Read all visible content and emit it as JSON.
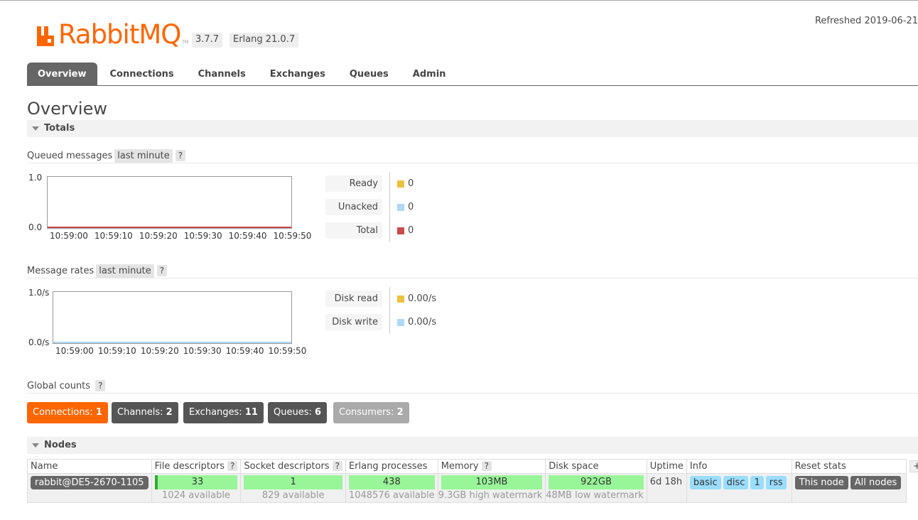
{
  "header": {
    "logo_text": "RabbitMQ",
    "logo_tm": "TM",
    "version": "3.7.7",
    "erlang": "Erlang 21.0.7",
    "refreshed": "Refreshed 2019-06-21"
  },
  "tabs": [
    "Overview",
    "Connections",
    "Channels",
    "Exchanges",
    "Queues",
    "Admin"
  ],
  "page_title": "Overview",
  "totals": {
    "heading": "Totals",
    "queued": {
      "label": "Queued messages",
      "range": "last minute",
      "help": "?",
      "y_max": "1.0",
      "y_min": "0.0",
      "ticks": [
        "10:59:00",
        "10:59:10",
        "10:59:20",
        "10:59:30",
        "10:59:40",
        "10:59:50"
      ],
      "legend": [
        {
          "label": "Ready",
          "value": "0",
          "color": "#edc240"
        },
        {
          "label": "Unacked",
          "value": "0",
          "color": "#afd8f8"
        },
        {
          "label": "Total",
          "value": "0",
          "color": "#cb4b4b"
        }
      ]
    },
    "rates": {
      "label": "Message rates",
      "range": "last minute",
      "help": "?",
      "y_max": "1.0/s",
      "y_min": "0.0/s",
      "ticks": [
        "10:59:00",
        "10:59:10",
        "10:59:20",
        "10:59:30",
        "10:59:40",
        "10:59:50"
      ],
      "legend": [
        {
          "label": "Disk read",
          "value": "0.00/s",
          "color": "#edc240"
        },
        {
          "label": "Disk write",
          "value": "0.00/s",
          "color": "#afd8f8"
        }
      ]
    },
    "global": {
      "label": "Global counts",
      "help": "?",
      "badges": [
        {
          "label": "Connections:",
          "value": "1",
          "color": "#f60"
        },
        {
          "label": "Channels:",
          "value": "2",
          "color": "#555"
        },
        {
          "label": "Exchanges:",
          "value": "11",
          "color": "#555"
        },
        {
          "label": "Queues:",
          "value": "6",
          "color": "#555"
        },
        {
          "label": "Consumers:",
          "value": "2",
          "color": "#aaa"
        }
      ]
    }
  },
  "nodes": {
    "heading": "Nodes",
    "columns": {
      "name": "Name",
      "fd": "File descriptors",
      "sd": "Socket descriptors",
      "ep": "Erlang processes",
      "mem": "Memory",
      "disk": "Disk space",
      "uptime": "Uptime",
      "info": "Info",
      "reset": "Reset stats",
      "toggle": "+/-",
      "help": "?"
    },
    "row": {
      "name": "rabbit@DE5-2670-1105",
      "fd": "33",
      "fd_sub": "1024 available",
      "sd": "1",
      "sd_sub": "829 available",
      "ep": "438",
      "ep_sub": "1048576 available",
      "mem": "103MB",
      "mem_sub": "9.3GB high watermark",
      "disk": "922GB",
      "disk_sub": "48MB low watermark",
      "uptime": "6d 18h",
      "info": [
        "basic",
        "disc",
        "1",
        "rss"
      ],
      "reset": [
        "This node",
        "All nodes"
      ]
    }
  }
}
